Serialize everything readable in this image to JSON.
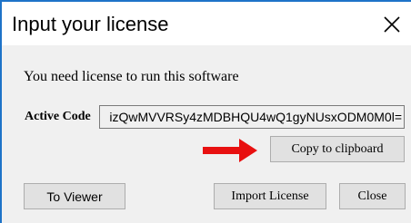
{
  "window": {
    "title": "Input your license",
    "close_icon": "close-icon"
  },
  "dialog": {
    "message": "You need license to run this software",
    "active_code_label": "Active Code",
    "active_code_value": "izQwMVVRSy4zMDBHQU4wQ1gyNUsxODM0M0l=",
    "copy_button_label": "Copy to clipboard",
    "arrow_icon": "red-arrow-right-icon",
    "arrow_color": "#e81010",
    "to_viewer_button_label": "To Viewer",
    "import_license_button_label": "Import License",
    "close_button_label": "Close"
  },
  "colors": {
    "window_border": "#1e73c8",
    "client_background": "#f0f0f0",
    "button_face": "#e1e1e1",
    "button_border": "#adadad"
  }
}
